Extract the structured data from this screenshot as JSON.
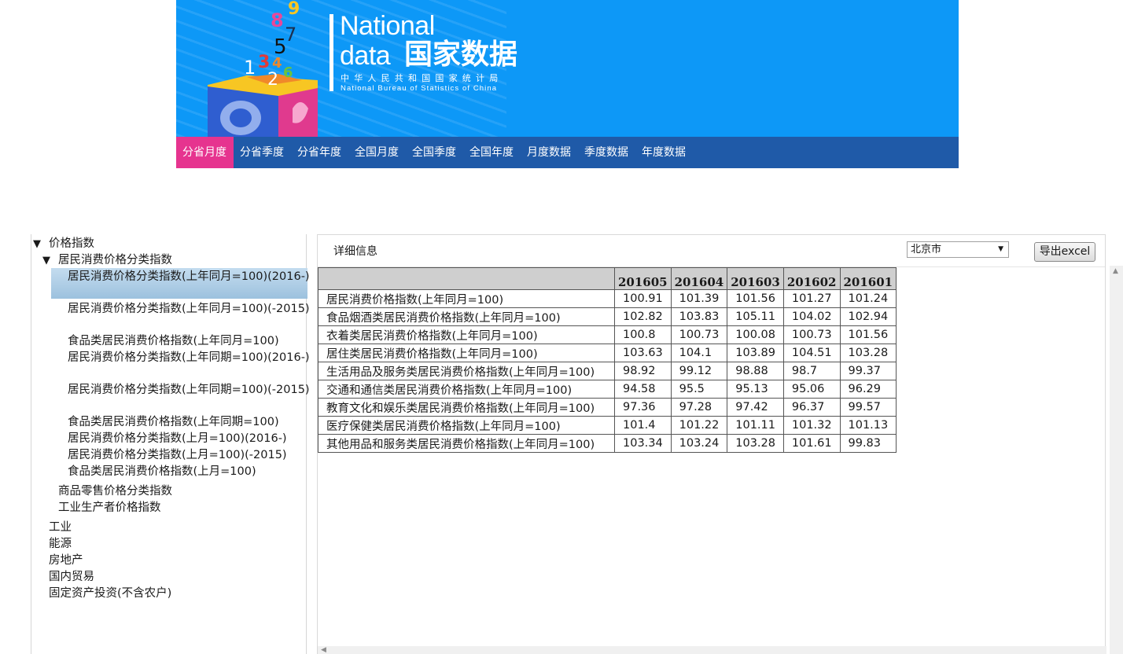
{
  "header": {
    "logo_en_line1": "National",
    "logo_en_line2": "data",
    "logo_cn": "国家数据",
    "logo_sub_cn": "中华人民共和国国家统计局",
    "logo_sub_en": "National Bureau of Statistics of China",
    "digits": [
      "8",
      "9",
      "7",
      "5",
      "3",
      "4",
      "1",
      "6",
      "2"
    ]
  },
  "nav": {
    "items": [
      {
        "label": "分省月度",
        "active": true
      },
      {
        "label": "分省季度"
      },
      {
        "label": "分省年度"
      },
      {
        "label": "全国月度"
      },
      {
        "label": "全国季度"
      },
      {
        "label": "全国年度"
      },
      {
        "label": "月度数据"
      },
      {
        "label": "季度数据"
      },
      {
        "label": "年度数据"
      }
    ]
  },
  "tree": {
    "root": "价格指数",
    "group": "居民消费价格分类指数",
    "leaves": [
      "居民消费价格分类指数(上年同月=100)(2016-)",
      "居民消费价格分类指数(上年同月=100)(-2015)",
      "食品类居民消费价格指数(上年同月=100)",
      "居民消费价格分类指数(上年同期=100)(2016-)",
      "居民消费价格分类指数(上年同期=100)(-2015)",
      "食品类居民消费价格指数(上年同期=100)",
      "居民消费价格分类指数(上月=100)(2016-)",
      "居民消费价格分类指数(上月=100)(-2015)",
      "食品类居民消费价格指数(上月=100)"
    ],
    "siblings": [
      "商品零售价格分类指数",
      "工业生产者价格指数"
    ],
    "top_items": [
      "工业",
      "能源",
      "房地产",
      "国内贸易",
      "固定资产投资(不含农户)"
    ]
  },
  "panel": {
    "title": "详细信息",
    "region_value": "北京市",
    "export_label": "导出excel"
  },
  "table": {
    "columns": [
      "201605",
      "201604",
      "201603",
      "201602",
      "201601"
    ],
    "rows": [
      {
        "label": "居民消费价格指数(上年同月=100)",
        "values": [
          "100.91",
          "101.39",
          "101.56",
          "101.27",
          "101.24"
        ]
      },
      {
        "label": "食品烟酒类居民消费价格指数(上年同月=100)",
        "values": [
          "102.82",
          "103.83",
          "105.11",
          "104.02",
          "102.94"
        ]
      },
      {
        "label": "衣着类居民消费价格指数(上年同月=100)",
        "values": [
          "100.8",
          "100.73",
          "100.08",
          "100.73",
          "101.56"
        ]
      },
      {
        "label": "居住类居民消费价格指数(上年同月=100)",
        "values": [
          "103.63",
          "104.1",
          "103.89",
          "104.51",
          "103.28"
        ]
      },
      {
        "label": "生活用品及服务类居民消费价格指数(上年同月=100)",
        "values": [
          "98.92",
          "99.12",
          "98.88",
          "98.7",
          "99.37"
        ]
      },
      {
        "label": "交通和通信类居民消费价格指数(上年同月=100)",
        "values": [
          "94.58",
          "95.5",
          "95.13",
          "95.06",
          "96.29"
        ]
      },
      {
        "label": "教育文化和娱乐类居民消费价格指数(上年同月=100)",
        "values": [
          "97.36",
          "97.28",
          "97.42",
          "96.37",
          "99.57"
        ]
      },
      {
        "label": "医疗保健类居民消费价格指数(上年同月=100)",
        "values": [
          "101.4",
          "101.22",
          "101.11",
          "101.32",
          "101.13"
        ]
      },
      {
        "label": "其他用品和服务类居民消费价格指数(上年同月=100)",
        "values": [
          "103.34",
          "103.24",
          "103.28",
          "101.61",
          "99.83"
        ]
      }
    ]
  }
}
